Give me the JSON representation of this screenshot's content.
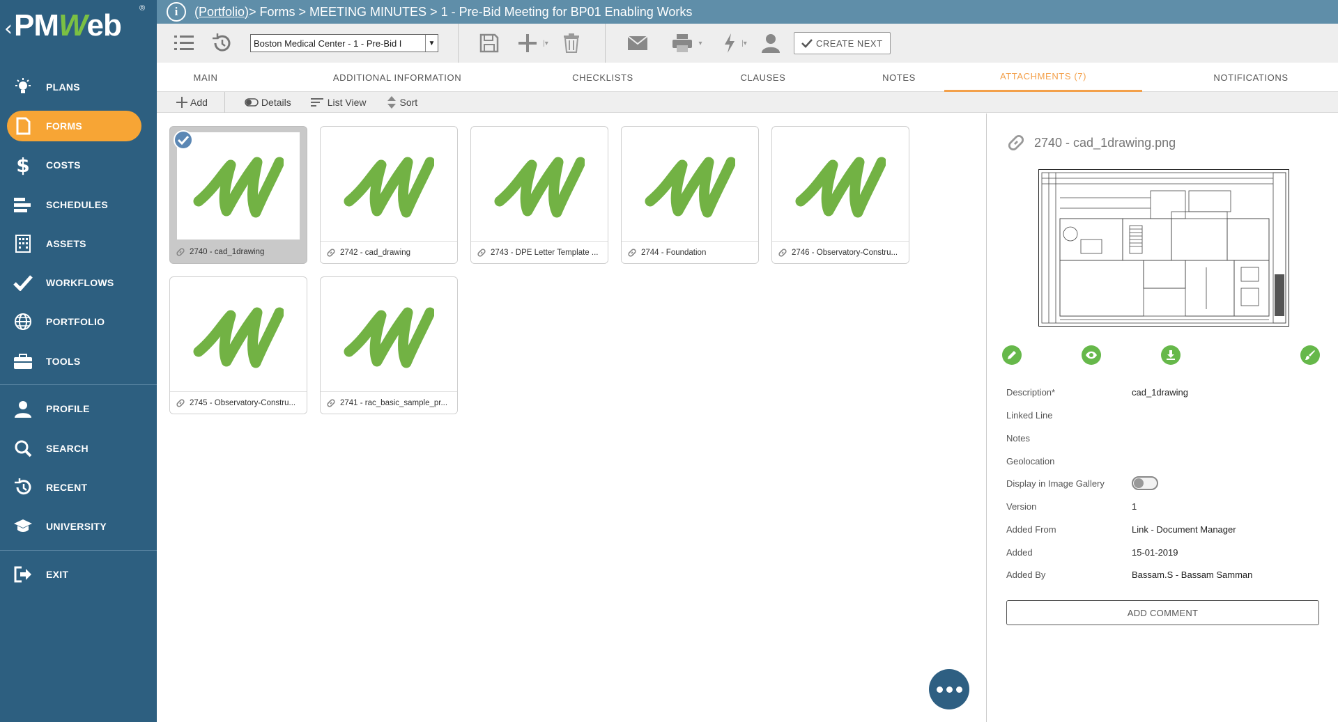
{
  "app": {
    "brand_pm": "PM",
    "brand_w": "W",
    "brand_eb": "eb",
    "reg": "®"
  },
  "breadcrumb": {
    "portfolio": "(Portfolio)",
    "rest": " > Forms > MEETING MINUTES > 1 - Pre-Bid Meeting for BP01 Enabling Works"
  },
  "sidebar": {
    "items": [
      {
        "label": "PLANS",
        "icon": "lightbulb-icon"
      },
      {
        "label": "FORMS",
        "icon": "document-icon"
      },
      {
        "label": "COSTS",
        "icon": "dollar-icon"
      },
      {
        "label": "SCHEDULES",
        "icon": "gantt-icon"
      },
      {
        "label": "ASSETS",
        "icon": "building-icon"
      },
      {
        "label": "WORKFLOWS",
        "icon": "checkmark-icon"
      },
      {
        "label": "PORTFOLIO",
        "icon": "globe-icon"
      },
      {
        "label": "TOOLS",
        "icon": "toolbox-icon"
      },
      {
        "label": "PROFILE",
        "icon": "user-icon"
      },
      {
        "label": "SEARCH",
        "icon": "search-icon"
      },
      {
        "label": "RECENT",
        "icon": "history-icon"
      },
      {
        "label": "UNIVERSITY",
        "icon": "graduation-cap-icon"
      },
      {
        "label": "EXIT",
        "icon": "exit-icon"
      }
    ]
  },
  "toolbar": {
    "record_select": "Boston Medical Center - 1 - Pre-Bid I",
    "create_next": "CREATE NEXT"
  },
  "tabs": [
    {
      "label": "MAIN"
    },
    {
      "label": "ADDITIONAL INFORMATION"
    },
    {
      "label": "CHECKLISTS"
    },
    {
      "label": "CLAUSES"
    },
    {
      "label": "NOTES"
    },
    {
      "label": "ATTACHMENTS (7)"
    },
    {
      "label": "NOTIFICATIONS"
    }
  ],
  "subtoolbar": {
    "add": "Add",
    "details": "Details",
    "list_view": "List View",
    "sort": "Sort"
  },
  "attachments": [
    {
      "caption": "2740 - cad_1drawing"
    },
    {
      "caption": "2742 - cad_drawing"
    },
    {
      "caption": "2743 - DPE Letter Template ..."
    },
    {
      "caption": "2744 - Foundation"
    },
    {
      "caption": "2746 - Observatory-Constru..."
    },
    {
      "caption": "2745 - Observatory-Constru..."
    },
    {
      "caption": "2741 - rac_basic_sample_pr..."
    }
  ],
  "detail": {
    "title": "2740 - cad_1drawing.png",
    "fields": [
      {
        "label": "Description*",
        "value": "cad_1drawing"
      },
      {
        "label": "Linked Line",
        "value": ""
      },
      {
        "label": "Notes",
        "value": ""
      },
      {
        "label": "Geolocation",
        "value": ""
      },
      {
        "label": "Display in Image Gallery",
        "value": ""
      },
      {
        "label": "Version",
        "value": "1"
      },
      {
        "label": "Added From",
        "value": "Link - Document Manager"
      },
      {
        "label": "Added",
        "value": "15-01-2019"
      },
      {
        "label": "Added By",
        "value": "Bassam.S - Bassam Samman"
      }
    ],
    "add_comment": "ADD COMMENT"
  },
  "colors": {
    "sidebar_bg": "#2d5f80",
    "accent_orange": "#f7a535",
    "titlebar_bg": "#5f8ea9",
    "brand_green": "#7bc043",
    "action_green": "#66b84a"
  }
}
